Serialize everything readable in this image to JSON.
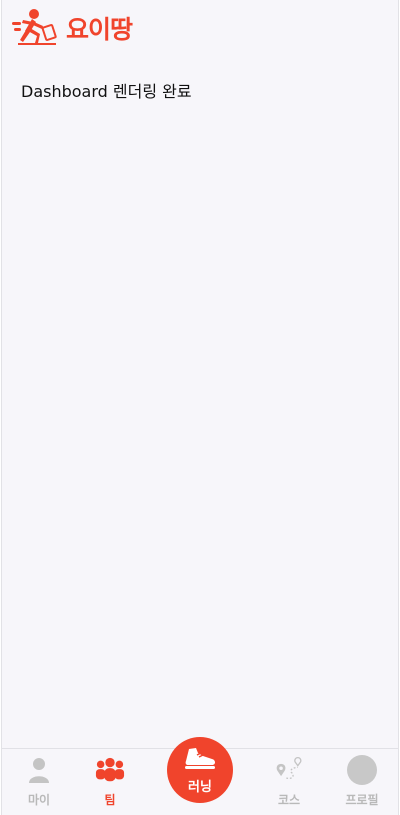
{
  "header": {
    "brand": "요이땅",
    "logo_icon": "runner-logo-icon",
    "brand_color": "#f0442c"
  },
  "main": {
    "status_text": "Dashboard 렌더링 완료"
  },
  "bottom_nav": {
    "items": [
      {
        "label": "마이",
        "icon": "person-icon",
        "active": false
      },
      {
        "label": "팀",
        "icon": "team-icon",
        "active": true
      },
      {
        "label": "러닝",
        "icon": "running-shoe-icon",
        "active": false
      },
      {
        "label": "코스",
        "icon": "route-pin-icon",
        "active": false
      },
      {
        "label": "프로필",
        "icon": "avatar-icon",
        "active": false
      }
    ],
    "active_color": "#f0442c",
    "inactive_color": "#b9b9b9"
  }
}
